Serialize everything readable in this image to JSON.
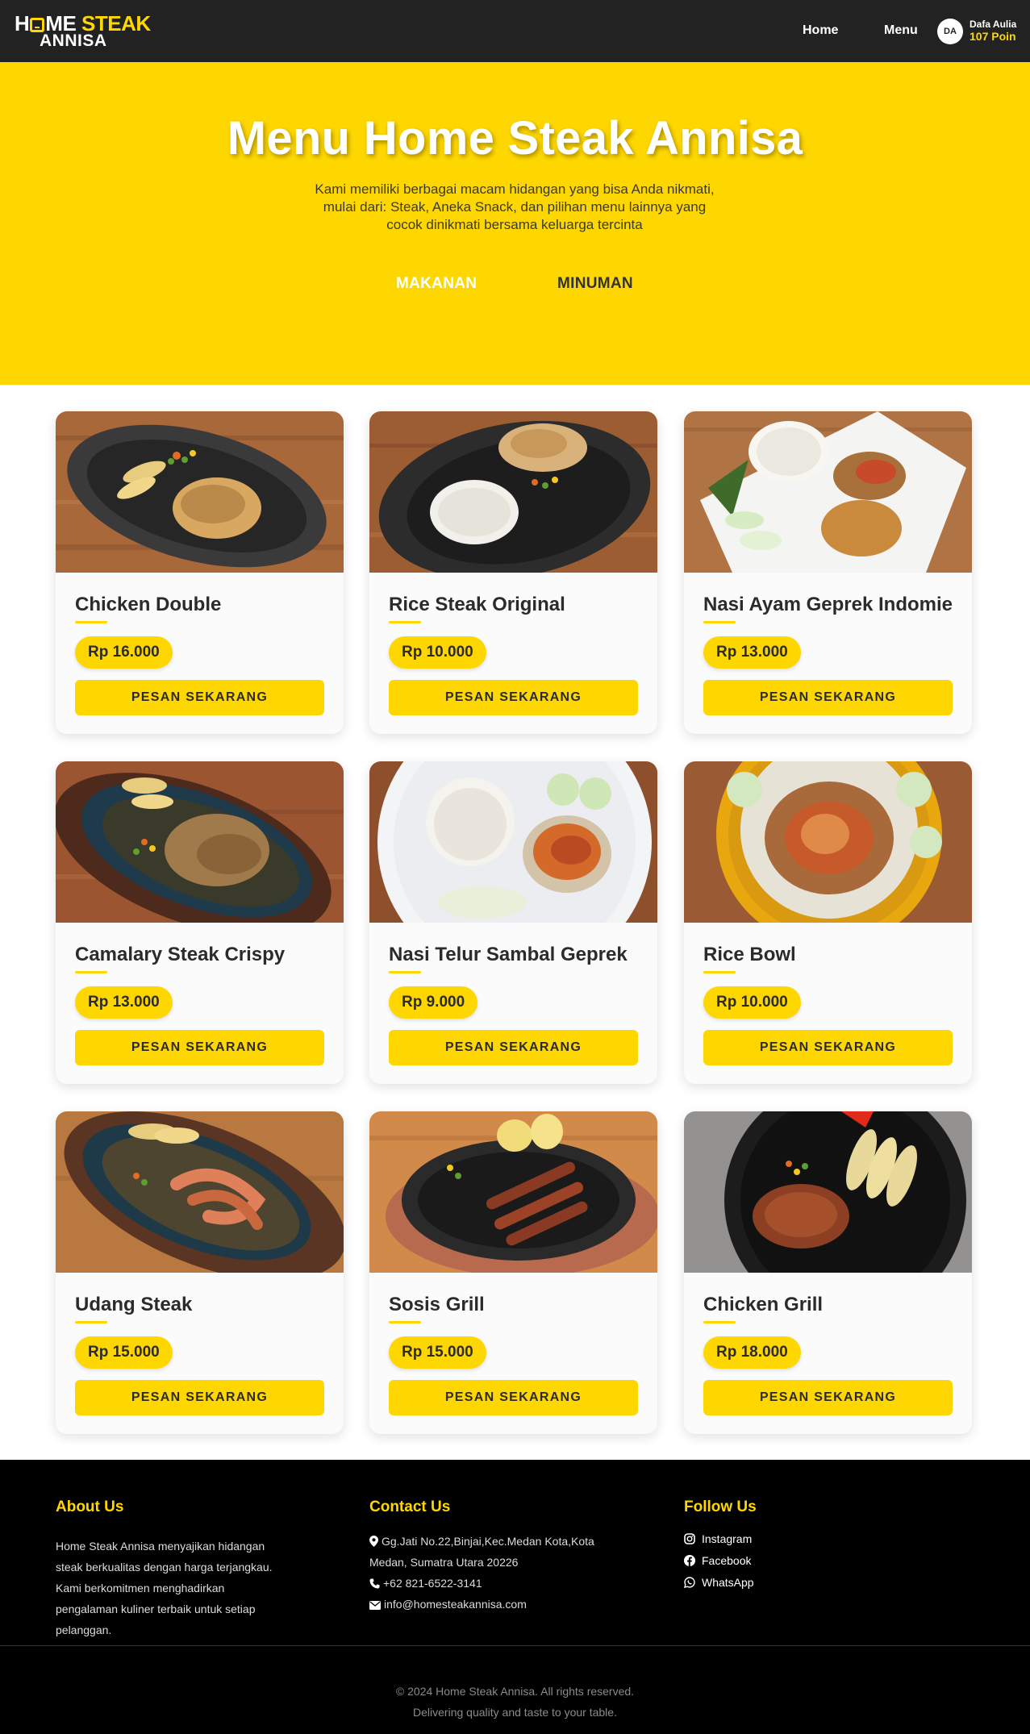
{
  "brand": {
    "line1_a": "H",
    "line1_b": "ME",
    "line1_c": "STEAK",
    "line2": "ANNISA"
  },
  "nav": {
    "home": "Home",
    "menu": "Menu"
  },
  "user": {
    "initials": "DA",
    "name": "Dafa Aulia",
    "points": "107 Poin"
  },
  "hero": {
    "title": "Menu Home Steak Annisa",
    "description": "Kami memiliki berbagai macam hidangan yang bisa Anda nikmati, mulai dari: Steak, Aneka Snack, dan pilihan menu lainnya yang cocok dinikmati bersama keluarga tercinta",
    "tabs": [
      "MAKANAN",
      "MINUMAN"
    ]
  },
  "menu_items": [
    {
      "name": "Chicken Double",
      "price": "Rp 16.000",
      "button": "PESAN SEKARANG"
    },
    {
      "name": "Rice Steak Original",
      "price": "Rp 10.000",
      "button": "PESAN SEKARANG"
    },
    {
      "name": "Nasi Ayam Geprek Indomie",
      "price": "Rp 13.000",
      "button": "PESAN SEKARANG"
    },
    {
      "name": "Camalary Steak Crispy",
      "price": "Rp 13.000",
      "button": "PESAN SEKARANG"
    },
    {
      "name": "Nasi Telur Sambal Geprek",
      "price": "Rp 9.000",
      "button": "PESAN SEKARANG"
    },
    {
      "name": "Rice Bowl",
      "price": "Rp 10.000",
      "button": "PESAN SEKARANG"
    },
    {
      "name": "Udang Steak",
      "price": "Rp 15.000",
      "button": "PESAN SEKARANG"
    },
    {
      "name": "Sosis Grill",
      "price": "Rp 15.000",
      "button": "PESAN SEKARANG"
    },
    {
      "name": "Chicken Grill",
      "price": "Rp 18.000",
      "button": "PESAN SEKARANG"
    }
  ],
  "footer": {
    "about": {
      "heading": "About Us",
      "text": "Home Steak Annisa menyajikan hidangan steak berkualitas dengan harga terjangkau. Kami berkomitmen menghadirkan pengalaman kuliner terbaik untuk setiap pelanggan."
    },
    "contact": {
      "heading": "Contact Us",
      "address_line1": "Gg.Jati No.22,Binjai,Kec.Medan Kota,Kota",
      "address_line2": "Medan, Sumatra Utara 20226",
      "phone": "+62 821-6522-3141",
      "email": "info@homesteakannisa.com"
    },
    "follow": {
      "heading": "Follow Us",
      "links": [
        "Instagram",
        "Facebook",
        "WhatsApp"
      ]
    },
    "copyright_line1": "© 2024 Home Steak Annisa. All rights reserved.",
    "copyright_line2": "Delivering quality and taste to your table."
  },
  "colors": {
    "accent": "#FFD700",
    "navbar": "#222222",
    "footer": "#000000",
    "text": "#2b2b2b"
  },
  "icons": [
    "map-marker-icon",
    "phone-icon",
    "envelope-icon",
    "instagram-icon",
    "facebook-icon",
    "whatsapp-icon"
  ]
}
